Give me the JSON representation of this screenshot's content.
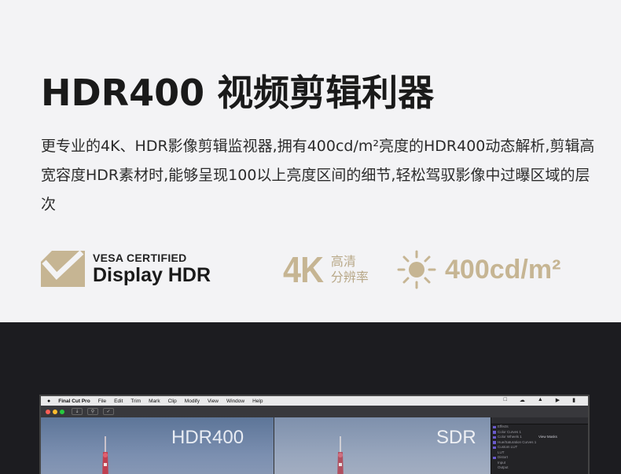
{
  "headline": "HDR400 视频剪辑利器",
  "description": "更专业的4K、HDR影像剪辑监视器,拥有400cd/m²亮度的HDR400动态解析,剪辑高宽容度HDR素材时,能够呈现100以上亮度区间的细节,轻松驾驭影像中过曝区域的层次",
  "badges": {
    "vesa_line1": "VESA CERTIFIED",
    "vesa_line2": "Display HDR",
    "k4_big": "4K",
    "k4_small_1": "高清",
    "k4_small_2": "分辨率",
    "nits": "400cd/m²"
  },
  "colors": {
    "gold": "#c6b593",
    "dark_bg": "#1c1c20",
    "light_bg": "#f3f3f5"
  },
  "app": {
    "menu": [
      "Final Cut Pro",
      "File",
      "Edit",
      "Trim",
      "Mark",
      "Clip",
      "Modify",
      "View",
      "Window",
      "Help"
    ],
    "viewer_left_label": "HDR400",
    "viewer_right_label": "SDR",
    "inspector_rows": [
      {
        "label": "Effects",
        "value": ""
      },
      {
        "label": "Color Curves 1",
        "value": ""
      },
      {
        "label": "Color Wheels 1",
        "value": "View Masks"
      },
      {
        "label": "Hue/Saturation Curves 1",
        "value": ""
      },
      {
        "label": "Custom LUT",
        "value": ""
      },
      {
        "label": "LUT",
        "value": ""
      },
      {
        "label": "Distort",
        "value": ""
      },
      {
        "label": "Input",
        "value": ""
      },
      {
        "label": "Output",
        "value": ""
      }
    ]
  }
}
